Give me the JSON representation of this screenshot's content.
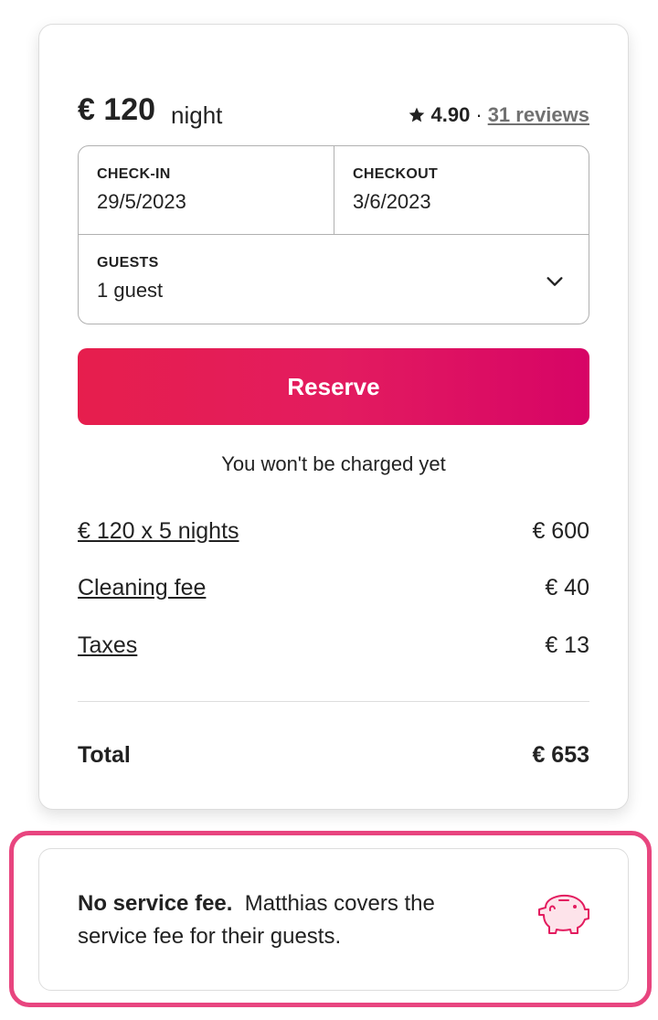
{
  "booking": {
    "price": "€ 120",
    "per_night": "night",
    "rating": "4.90",
    "rating_separator": "·",
    "reviews_link": "31 reviews",
    "checkin_label": "CHECK-IN",
    "checkin_value": "29/5/2023",
    "checkout_label": "CHECKOUT",
    "checkout_value": "3/6/2023",
    "guests_label": "GUESTS",
    "guests_value": "1 guest",
    "reserve_label": "Reserve",
    "charge_note": "You won't be charged yet",
    "line_items": [
      {
        "label": "€ 120 x 5 nights",
        "amount": "€ 600"
      },
      {
        "label": "Cleaning fee",
        "amount": "€ 40"
      },
      {
        "label": "Taxes",
        "amount": "€ 13"
      }
    ],
    "total_label": "Total",
    "total_amount": "€ 653"
  },
  "service_fee": {
    "title": "No service fee.",
    "message": "Matthias covers the service fee for their guests.",
    "icon": "piggy-bank-icon"
  },
  "colors": {
    "brand": "#e31c5f",
    "highlight": "#e8457f",
    "text": "#222222",
    "muted": "#717171"
  }
}
